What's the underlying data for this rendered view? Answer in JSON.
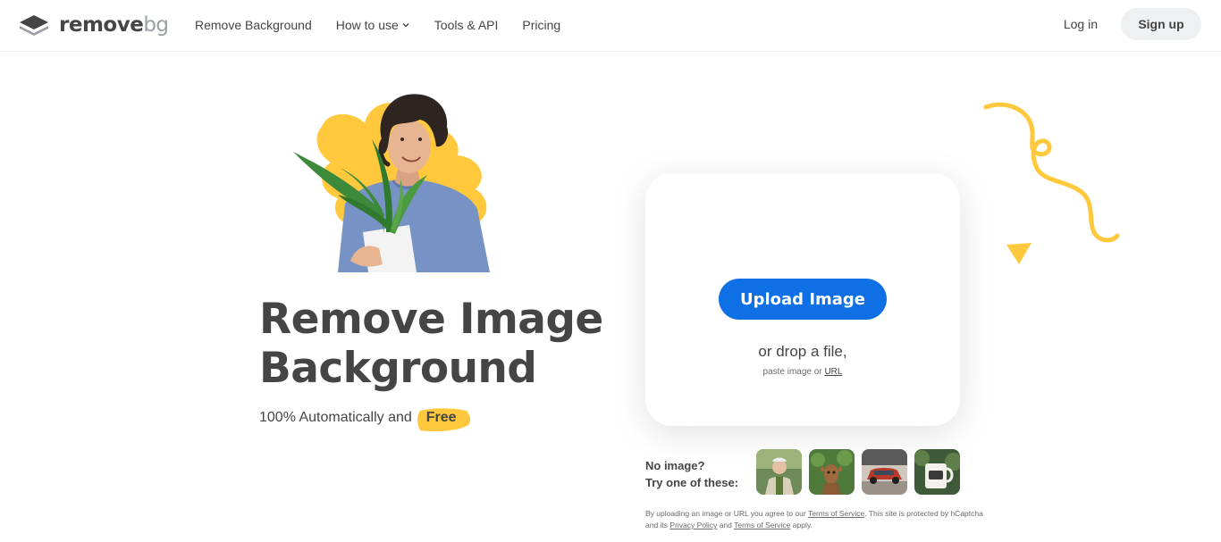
{
  "nav": {
    "logo_main": "remove",
    "logo_accent": "bg",
    "links": [
      "Remove Background",
      "How to use",
      "Tools & API",
      "Pricing"
    ],
    "login": "Log in",
    "signup": "Sign up"
  },
  "hero": {
    "title_line1": "Remove Image",
    "title_line2": "Background",
    "subtitle": "100% Automatically and",
    "highlight": "Free"
  },
  "upload": {
    "button": "Upload Image",
    "drop_text": "or drop a file,",
    "paste_text": "paste image or",
    "url_link": "URL"
  },
  "samples": {
    "line1": "No image?",
    "line2": "Try one of these:",
    "thumbs": [
      "sample-person",
      "sample-deer",
      "sample-car",
      "sample-mug"
    ]
  },
  "legal": {
    "part1": "By uploading an image or URL you agree to our",
    "terms": "Terms of Service",
    "part2": ". This site is protected by hCaptcha and its",
    "privacy": "Privacy Policy",
    "part3": "and",
    "terms2": "Terms of Service",
    "part4": "apply."
  },
  "colors": {
    "primary": "#0f70e6",
    "accent_yellow": "#ffc83d",
    "text": "#454545"
  }
}
